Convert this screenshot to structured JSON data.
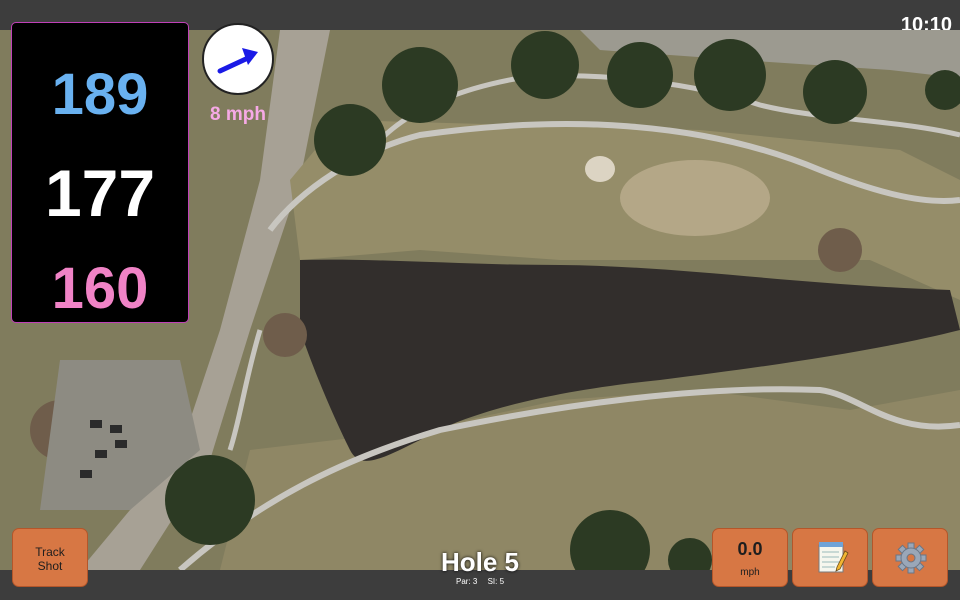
{
  "status_bar": {
    "time": "10:10"
  },
  "distances": {
    "back": "189",
    "middle": "177",
    "front": "160"
  },
  "wind": {
    "speed_label": "8 mph",
    "direction_icon": "arrow-icon"
  },
  "hole": {
    "title": "Hole 5",
    "par": "Par: 3",
    "si": "SI: 5"
  },
  "buttons": {
    "track_shot": "Track Shot",
    "wind_value": "0.0",
    "wind_unit": "mph",
    "notes_icon": "notepad-icon",
    "settings_icon": "gear-icon"
  },
  "colors": {
    "back": "#69b1f0",
    "middle": "#ffffff",
    "front": "#f083c6",
    "button": "#d77744",
    "wind_label": "#f6a9e6",
    "arrow": "#1a1ae6"
  }
}
